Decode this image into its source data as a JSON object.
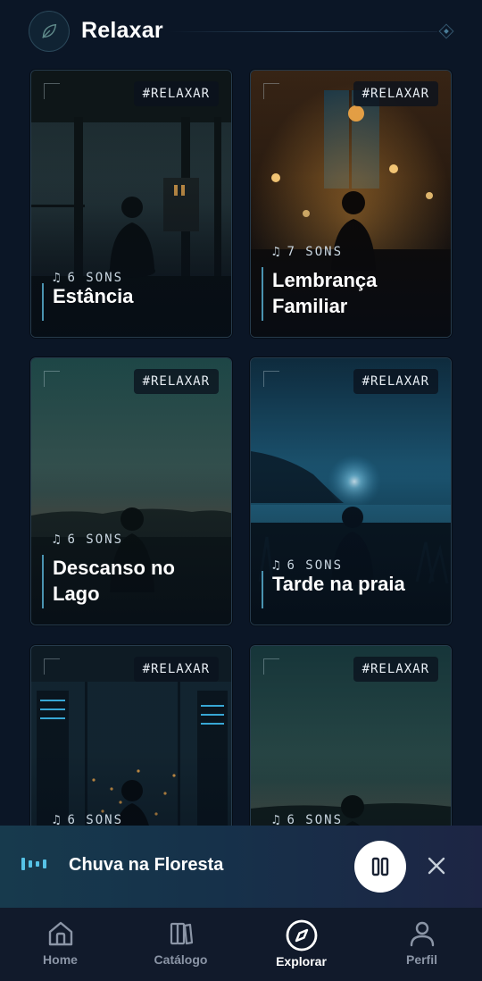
{
  "header": {
    "title": "Relaxar",
    "icon": "leaf-icon"
  },
  "cards": [
    {
      "tag": "#RELAXAR",
      "sons": "6 SONS",
      "title_lines": [
        "Estância"
      ]
    },
    {
      "tag": "#RELAXAR",
      "sons": "7 SONS",
      "title_lines": [
        "Lembrança",
        "Familiar"
      ]
    },
    {
      "tag": "#RELAXAR",
      "sons": "6 SONS",
      "title_lines": [
        "Descanso no",
        "Lago"
      ]
    },
    {
      "tag": "#RELAXAR",
      "sons": "6 SONS",
      "title_lines": [
        "Tarde na praia"
      ]
    },
    {
      "tag": "#RELAXAR",
      "sons": "6 SONS",
      "title_lines": [
        ""
      ]
    },
    {
      "tag": "#RELAXAR",
      "sons": "6 SONS",
      "title_lines": [
        ""
      ]
    }
  ],
  "player": {
    "track": "Chuva na Floresta",
    "state": "playing"
  },
  "nav": {
    "items": [
      {
        "label": "Home",
        "icon": "home-icon"
      },
      {
        "label": "Catálogo",
        "icon": "books-icon"
      },
      {
        "label": "Explorar",
        "icon": "compass-icon",
        "active": true
      },
      {
        "label": "Perfil",
        "icon": "user-icon"
      }
    ]
  },
  "colors": {
    "accent": "#56c2e6",
    "background": "#0b1626",
    "nav_bg": "#111a2b"
  }
}
